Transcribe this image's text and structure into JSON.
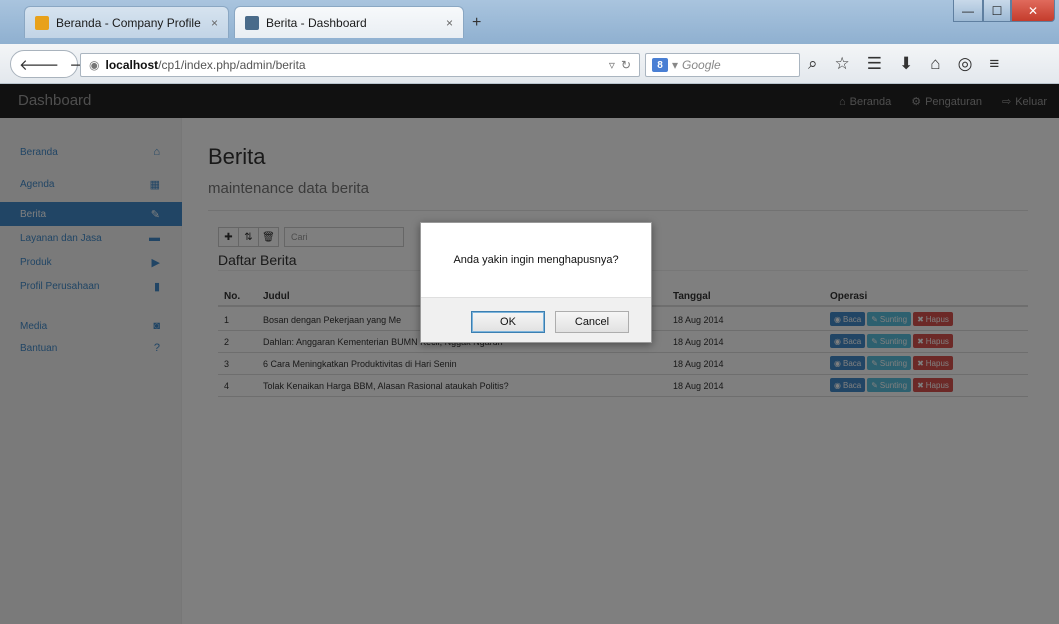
{
  "browser": {
    "tabs": [
      {
        "label": "Beranda - Company Profile",
        "close": "×",
        "favicon_color": "#e8a11a"
      },
      {
        "label": "Berita - Dashboard",
        "close": "×",
        "favicon_color": "#4a6b8a"
      }
    ],
    "new_tab": "+",
    "url_host": "localhost",
    "url_path": "/cp1/index.php/admin/berita",
    "search_placeholder": "Google"
  },
  "app": {
    "brand": "Dashboard",
    "top_links": [
      {
        "icon": "home-icon",
        "label": "Beranda"
      },
      {
        "icon": "gear-icon",
        "label": "Pengaturan"
      },
      {
        "icon": "logout-icon",
        "label": "Keluar"
      }
    ]
  },
  "sidebar": {
    "items": [
      {
        "label": "Beranda",
        "icon": "home-icon"
      },
      {
        "label": "Agenda",
        "icon": "calendar-icon"
      },
      {
        "label": "Berita",
        "icon": "pencil-icon",
        "active": true
      },
      {
        "label": "Layanan dan Jasa",
        "icon": "briefcase-icon"
      },
      {
        "label": "Produk",
        "icon": "tag-icon"
      },
      {
        "label": "Profil Perusahaan",
        "icon": "chart-icon"
      },
      {
        "label": "Media",
        "icon": "camera-icon"
      },
      {
        "label": "Bantuan",
        "icon": "question-icon"
      }
    ]
  },
  "main": {
    "title": "Berita",
    "subtitle": "maintenance data berita",
    "search_placeholder": "Cari",
    "section_title": "Daftar Berita",
    "columns": [
      "No.",
      "Judul",
      "Tanggal",
      "Operasi"
    ],
    "rows": [
      {
        "no": "1",
        "judul": "Bosan dengan Pekerjaan yang Me",
        "tanggal": "18 Aug 2014"
      },
      {
        "no": "2",
        "judul": "Dahlan: Anggaran Kementerian BUMN Kecil, Nggak Ngaruh",
        "tanggal": "18 Aug 2014"
      },
      {
        "no": "3",
        "judul": "6 Cara Meningkatkan Produktivitas di Hari Senin",
        "tanggal": "18 Aug 2014"
      },
      {
        "no": "4",
        "judul": "Tolak Kenaikan Harga BBM, Alasan Rasional ataukah Politis?",
        "tanggal": "18 Aug 2014"
      }
    ],
    "ops": {
      "read": "Baca",
      "edit": "Sunting",
      "delete": "Hapus"
    }
  },
  "dialog": {
    "message": "Anda yakin ingin menghapusnya?",
    "ok": "OK",
    "cancel": "Cancel"
  }
}
